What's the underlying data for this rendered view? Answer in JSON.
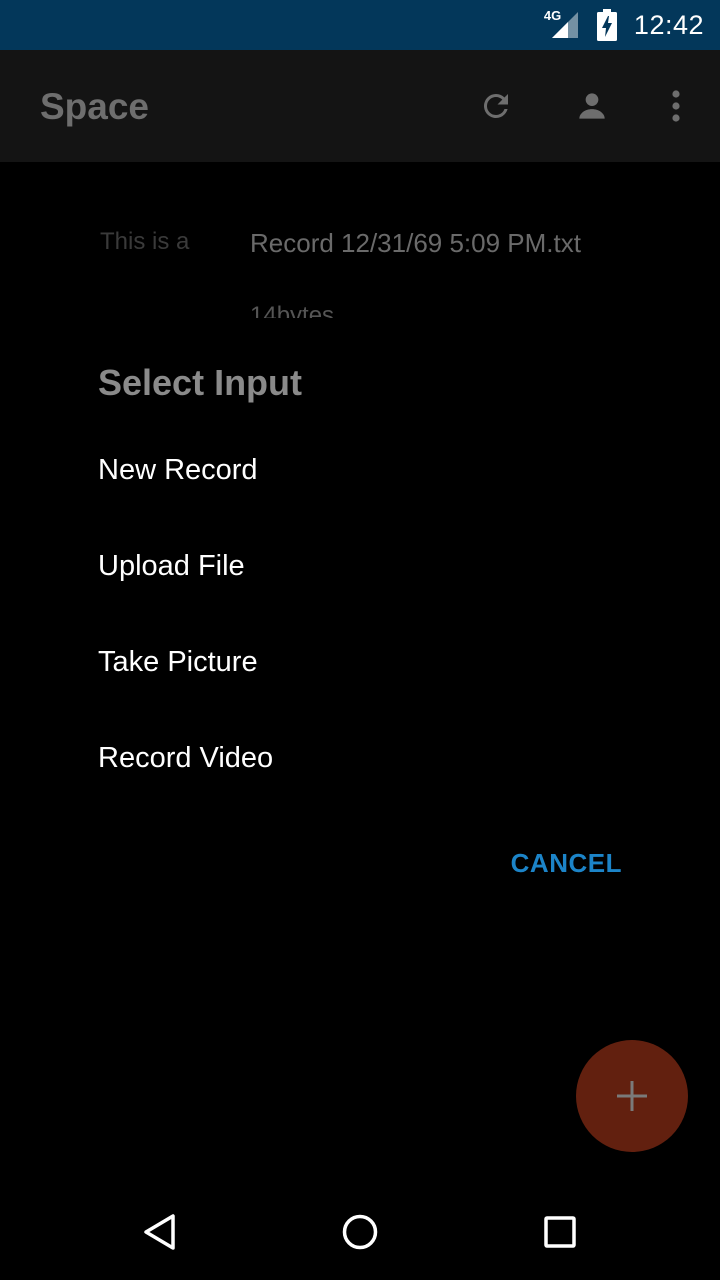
{
  "status_bar": {
    "network": "4G",
    "time": "12:42"
  },
  "app_bar": {
    "title": "Space",
    "icons": [
      "refresh-icon",
      "account-icon",
      "more-vert-icon"
    ]
  },
  "background": {
    "preview_text": "This is a",
    "filename": "Record 12/31/69 5:09 PM.txt",
    "size": "14bytes"
  },
  "dialog": {
    "title": "Select Input",
    "options": [
      "New Record",
      "Upload File",
      "Take Picture",
      "Record Video"
    ],
    "cancel_label": "CANCEL"
  },
  "fab": {
    "icon": "plus-icon"
  },
  "nav_bar": {
    "icons": [
      "back-icon",
      "home-icon",
      "recents-icon"
    ]
  },
  "colors": {
    "status_bar": "#03375a",
    "accent": "#1c84c8",
    "fab": "#62200f"
  }
}
